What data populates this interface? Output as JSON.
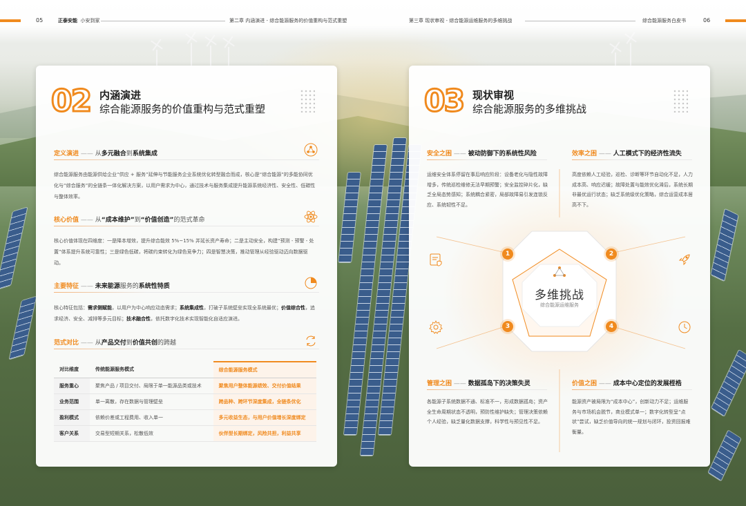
{
  "header": {
    "left_page": "05",
    "left_brand": "正泰安能",
    "left_slogan": "小安到家",
    "left_chapter": "第二章   内涵演进 - 综合能源服务的价值重构与范式重塑",
    "right_chapter": "第三章   现状审视 - 综合能源运维服务的多维挑战",
    "right_doc": "综合能源服务白皮书",
    "right_page": "06"
  },
  "left": {
    "number": "02",
    "title": "内涵演进",
    "subtitle": "综合能源服务的价值重构与范式重塑",
    "rows": [
      {
        "tag": "定义演进",
        "dash": "——",
        "pre": "从",
        "strong1": "多元融合",
        "mid": "到",
        "strong2": "系统集成",
        "post": "",
        "icon": "network-icon",
        "para": "综合能源服务由能源供给企业“供应 + 服务”延伸与节能服务企业系统优化转型融合而成，核心是“综合能源”的多能协同优化与“综合服务”的全链条一体化解决方案，以用户需求为中心，通过技术与服务集成提升能源系统经济性、安全性、低碳性与整体效率。"
      },
      {
        "tag": "核心价值",
        "dash": "——",
        "pre": "从",
        "strong1": "“成本维护”",
        "mid": "到",
        "strong2": "“价值创造”",
        "post": "的范式革命",
        "icon": "atom-icon",
        "para": "核心价值体现在四维度：一是降本增效，提升综合能效 5%~15% 并延长资产寿命；二是主动安全，构建“预测 - 预警 - 处置”体系提升系统可靠性；三是绿色低碳，将碳约束转化为绿色竞争力；四是智慧决策，推动管理从经验驱动迈向数据驱动。"
      },
      {
        "tag": "主要特征",
        "dash": "——",
        "pre": "",
        "strong1": "未来能源",
        "mid": "服务的",
        "strong2": "系统性特质",
        "post": "",
        "icon": "pie-chart-icon",
        "para_parts": [
          "核心特征包括：",
          "需求侧赋能",
          "，以用户为中心响应动态需求；",
          "系统集成性",
          "，打破子系统壁垒实现全系统最优；",
          "价值综合性",
          "，追求经济、安全、减排等多元目标；",
          "技术融合性",
          "，依托数字化技术实现智能化自适应演进。"
        ]
      },
      {
        "tag": "范式对比",
        "dash": "——",
        "pre": "从",
        "strong1": "产品交付",
        "mid": "到",
        "strong2": "价值共创",
        "post": "的跨越",
        "icon": "cycle-arrows-icon"
      }
    ],
    "table": {
      "headers": [
        "对比维度",
        "传统能源服务模式",
        "综合能源服务模式"
      ],
      "rows": [
        [
          "服务重心",
          "聚焦产品 / 项目交付、局限于单一能源品类或技术",
          "聚焦用户整体能源绩效、交付价值结果"
        ],
        [
          "业务范围",
          "单一离散，存在数据与管理壁垒",
          "跨品种、跨环节深度集成，全链条优化"
        ],
        [
          "盈利模式",
          "依赖价差或工程费用、收入单一",
          "多元收益生态，与用户价值增长深度绑定"
        ],
        [
          "客户关系",
          "交易型短期关系，松散低效",
          "伙伴型长期绑定，风险共担，利益共享"
        ]
      ]
    }
  },
  "right": {
    "number": "03",
    "title": "现状审视",
    "subtitle": "综合能源服务的多维挑战",
    "center_title": "多维挑战",
    "center_sub": "综合能源运维服务",
    "quadrants": [
      {
        "num": "1",
        "tag": "安全之困",
        "dash": "——",
        "head": "被动防御下的系统性风险",
        "icon": "shield-doc-icon",
        "para": "运维安全体系停留在事后响应阶段：设备老化与隐性故障增多，传统巡检维修无法早期预警；安全监控碎片化，缺乏全局态势感知；系统耦合紧密，局部故障易引发连锁反应、系统韧性不足。"
      },
      {
        "num": "2",
        "tag": "效率之困",
        "dash": "——",
        "head": "人工模式下的经济性流失",
        "icon": "rocket-icon",
        "para": "高度依赖人工经验，巡检、诊断等环节自动化不足，人力成本高、响应迟缓；故障处置与能效优化滞后，系统长期非最优运行状态；缺乏系统级优化策略，综合运营成本居高不下。"
      },
      {
        "num": "3",
        "tag": "管理之困",
        "dash": "——",
        "head": "数据孤岛下的决策失灵",
        "icon": "gear-icon",
        "para": "各能源子系统数据不通、标准不一，形成数据孤岛；资产全生命周期状态不透明，预防性维护缺失；管理决策依赖个人经验，缺乏量化数据支撑，科学性与预见性不足。"
      },
      {
        "num": "4",
        "tag": "价值之困",
        "dash": "——",
        "head": "成本中心定位的发展桎梏",
        "icon": "clock-icon",
        "para": "能源资产被局限为“成本中心”，创新动力不足；运维服务与市场机会脱节，商业模式单一；数字化转型呈“点状”尝试，缺乏价值导向的统一规划与闭环，投资回报难衡量。"
      }
    ]
  }
}
